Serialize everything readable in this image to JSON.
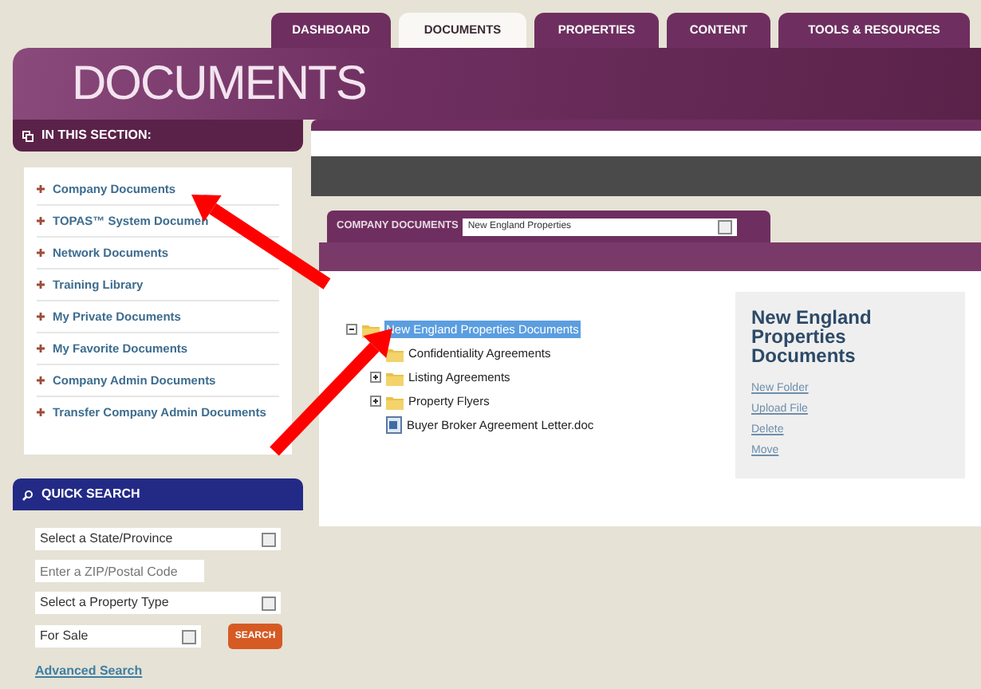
{
  "tabs": [
    {
      "label": "DASHBOARD",
      "selected": false
    },
    {
      "label": "DOCUMENTS",
      "selected": true
    },
    {
      "label": "PROPERTIES",
      "selected": false
    },
    {
      "label": "CONTENT",
      "selected": false
    },
    {
      "label": "TOOLS & RESOURCES",
      "selected": false
    }
  ],
  "page_title": "DOCUMENTS",
  "section_menu": {
    "heading": "IN THIS SECTION:",
    "items": [
      {
        "label": "Company Documents"
      },
      {
        "label": "TOPAS™ System Documen"
      },
      {
        "label": "Network Documents"
      },
      {
        "label": "Training Library"
      },
      {
        "label": "My Private Documents"
      },
      {
        "label": "My Favorite Documents"
      },
      {
        "label": "Company Admin Documents"
      },
      {
        "label": "Transfer Company Admin Documents"
      }
    ]
  },
  "quick_search": {
    "heading": "QUICK SEARCH",
    "state_select": "Select a State/Province",
    "zip_placeholder": "Enter a ZIP/Postal Code",
    "type_select": "Select a Property Type",
    "listing_select": "For Sale",
    "search_button": "SEARCH",
    "advanced_link": "Advanced Search"
  },
  "library_bar": {
    "label": "COMPANY DOCUMENTS",
    "select": "New England Properties"
  },
  "tree": [
    {
      "label": "New England Properties Documents",
      "kind": "folder",
      "expanded": true,
      "selected": true,
      "children": [
        {
          "label": "Confidentiality Agreements",
          "kind": "folder",
          "selected": false
        },
        {
          "label": "Listing Agreements",
          "kind": "folder",
          "expanded": false,
          "selected": false
        },
        {
          "label": "Property Flyers",
          "kind": "folder",
          "expanded": false,
          "selected": false
        },
        {
          "label": "Buyer Broker Agreement Letter.doc",
          "kind": "file",
          "selected": false
        }
      ]
    }
  ],
  "info_panel": {
    "title": "New England Properties Documents",
    "actions": [
      "New Folder",
      "Upload File",
      "Delete",
      "Move"
    ]
  },
  "annotations": [
    {
      "kind": "arrow"
    },
    {
      "kind": "arrow"
    }
  ]
}
